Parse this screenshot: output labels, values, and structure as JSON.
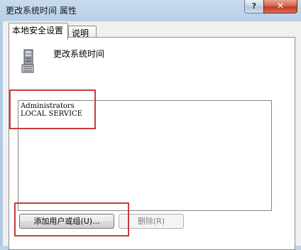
{
  "window": {
    "title": "更改系统时间 属性",
    "help_label": "?",
    "close_label": "✕"
  },
  "tabs": [
    {
      "label": "本地安全设置",
      "active": true
    },
    {
      "label": "说明",
      "active": false
    }
  ],
  "policy": {
    "icon": "server-computer-icon",
    "name": "更改系统时间"
  },
  "accounts": [
    "Administrators",
    "LOCAL SERVICE"
  ],
  "buttons": {
    "add_label": "添加用户或组(U)...",
    "remove_label": "删除(R)"
  },
  "colors": {
    "highlight": "#c83c3c",
    "close_button": "#c0391f"
  }
}
